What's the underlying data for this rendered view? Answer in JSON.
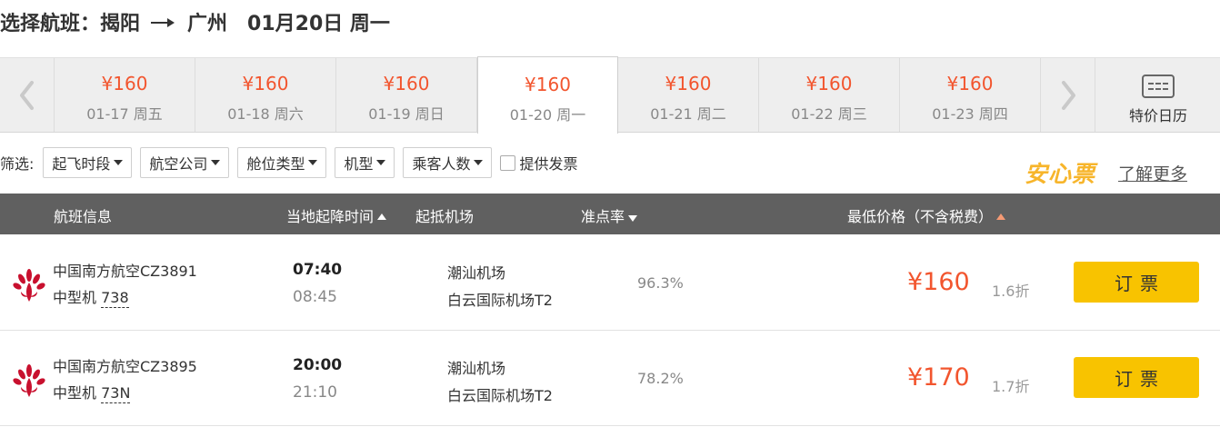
{
  "header": {
    "prefix": "选择航班：",
    "origin": "揭阳",
    "destination": "广州",
    "date": "01月20日 周一"
  },
  "date_strip": {
    "days": [
      {
        "price": "¥160",
        "date": "01-17 周五"
      },
      {
        "price": "¥160",
        "date": "01-18 周六"
      },
      {
        "price": "¥160",
        "date": "01-19 周日"
      },
      {
        "price": "¥160",
        "date": "01-20 周一"
      },
      {
        "price": "¥160",
        "date": "01-21 周二"
      },
      {
        "price": "¥160",
        "date": "01-22 周三"
      },
      {
        "price": "¥160",
        "date": "01-23 周四"
      }
    ],
    "active_index": 3,
    "calendar_label": "特价日历"
  },
  "filters": {
    "label": "筛选:",
    "dropdowns": [
      "起飞时段",
      "航空公司",
      "舱位类型",
      "机型",
      "乘客人数"
    ],
    "checkbox_label": "提供发票",
    "checkbox_checked": false
  },
  "promo": {
    "brand": "安心票",
    "link": "了解更多"
  },
  "table": {
    "headers": {
      "flight": "航班信息",
      "time": "当地起降时间",
      "airport": "起抵机场",
      "ontime": "准点率",
      "price": "最低价格（不含税费）"
    },
    "rows": [
      {
        "airline": "中国南方航空CZ3891",
        "model_type": "中型机",
        "model_code": "738",
        "depart": "07:40",
        "arrive": "08:45",
        "from_airport": "潮汕机场",
        "to_airport": "白云国际机场T2",
        "ontime": "96.3%",
        "price": "¥160",
        "discount": "1.6折",
        "book": "订票"
      },
      {
        "airline": "中国南方航空CZ3895",
        "model_type": "中型机",
        "model_code": "73N",
        "depart": "20:00",
        "arrive": "21:10",
        "from_airport": "潮汕机场",
        "to_airport": "白云国际机场T2",
        "ontime": "78.2%",
        "price": "¥170",
        "discount": "1.7折",
        "book": "订票"
      }
    ]
  },
  "colors": {
    "price": "#f2552e",
    "book_button": "#f8c300",
    "header_bar": "#606060",
    "brand": "#f7b52b"
  }
}
